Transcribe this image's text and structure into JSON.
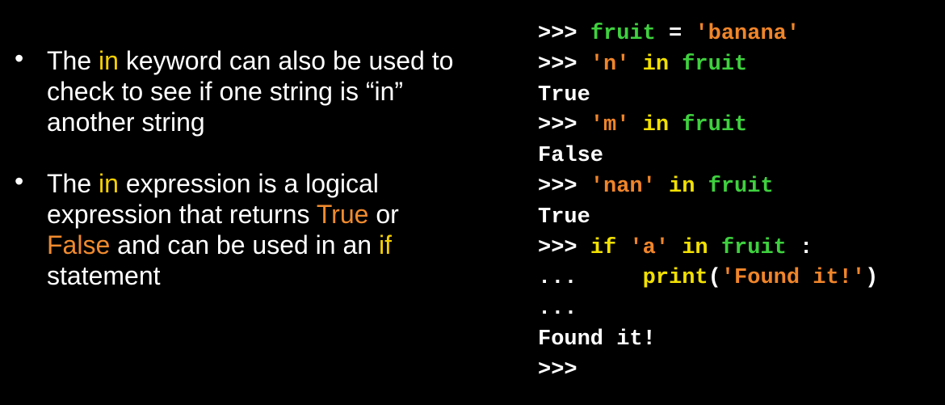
{
  "bullets": [
    {
      "parts": [
        {
          "text": "The ",
          "style": "plain"
        },
        {
          "text": "in",
          "style": "yellow"
        },
        {
          "text": " keyword can also be used to check to see if one string is “in” another string",
          "style": "plain"
        }
      ]
    },
    {
      "parts": [
        {
          "text": "The ",
          "style": "plain"
        },
        {
          "text": "in",
          "style": "yellow"
        },
        {
          "text": " expression is a logical expression that returns ",
          "style": "plain"
        },
        {
          "text": "True",
          "style": "orange"
        },
        {
          "text": " or ",
          "style": "plain"
        },
        {
          "text": "False",
          "style": "orange"
        },
        {
          "text": " and can be used in an ",
          "style": "plain"
        },
        {
          "text": "if",
          "style": "yellow"
        },
        {
          "text": " statement",
          "style": "plain"
        }
      ]
    }
  ],
  "code_lines": [
    [
      {
        "text": ">>> ",
        "c": "white"
      },
      {
        "text": "fruit",
        "c": "green"
      },
      {
        "text": " = ",
        "c": "white"
      },
      {
        "text": "'banana'",
        "c": "orange"
      }
    ],
    [
      {
        "text": ">>> ",
        "c": "white"
      },
      {
        "text": "'n'",
        "c": "orange"
      },
      {
        "text": " in ",
        "c": "yellow"
      },
      {
        "text": "fruit",
        "c": "green"
      }
    ],
    [
      {
        "text": "True",
        "c": "white"
      }
    ],
    [
      {
        "text": ">>> ",
        "c": "white"
      },
      {
        "text": "'m'",
        "c": "orange"
      },
      {
        "text": " in ",
        "c": "yellow"
      },
      {
        "text": "fruit",
        "c": "green"
      }
    ],
    [
      {
        "text": "False",
        "c": "white"
      }
    ],
    [
      {
        "text": ">>> ",
        "c": "white"
      },
      {
        "text": "'nan'",
        "c": "orange"
      },
      {
        "text": " in ",
        "c": "yellow"
      },
      {
        "text": "fruit",
        "c": "green"
      }
    ],
    [
      {
        "text": "True",
        "c": "white"
      }
    ],
    [
      {
        "text": ">>> ",
        "c": "white"
      },
      {
        "text": "if",
        "c": "yellow"
      },
      {
        "text": " ",
        "c": "white"
      },
      {
        "text": "'a'",
        "c": "orange"
      },
      {
        "text": " in ",
        "c": "yellow"
      },
      {
        "text": "fruit",
        "c": "green"
      },
      {
        "text": " :",
        "c": "white"
      }
    ],
    [
      {
        "text": "...     ",
        "c": "white"
      },
      {
        "text": "print",
        "c": "yellow"
      },
      {
        "text": "(",
        "c": "white"
      },
      {
        "text": "'Found it!'",
        "c": "orange"
      },
      {
        "text": ")",
        "c": "white"
      }
    ],
    [
      {
        "text": "...",
        "c": "white"
      }
    ],
    [
      {
        "text": "Found it!",
        "c": "white"
      }
    ],
    [
      {
        "text": ">>>",
        "c": "white"
      }
    ]
  ],
  "colors": {
    "background": "#000000",
    "text": "#ffffff",
    "yellow": "#f5d000",
    "orange": "#f08a2e",
    "code_green": "#3ed13e"
  }
}
